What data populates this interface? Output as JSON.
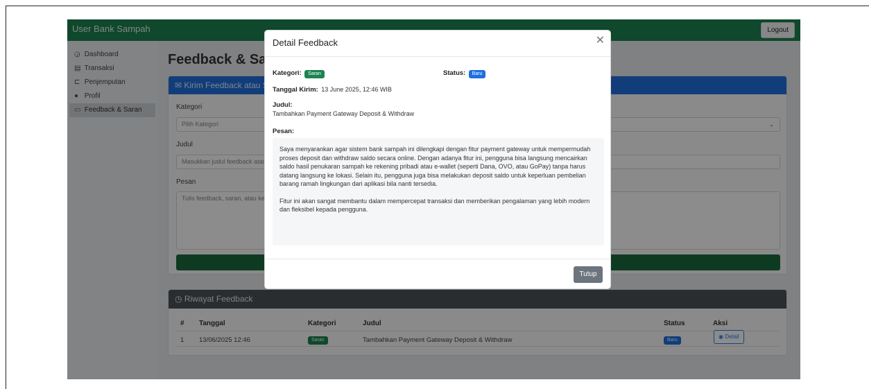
{
  "navbar": {
    "brand": "User Bank Sampah",
    "logout": "Logout"
  },
  "sidebar": {
    "items": [
      {
        "label": "Dashboard",
        "icon": "dashboard-icon",
        "glyph": "◶"
      },
      {
        "label": "Transaksi",
        "icon": "receipt-icon",
        "glyph": "▤"
      },
      {
        "label": "Penjemputan",
        "icon": "truck-icon",
        "glyph": "⊏"
      },
      {
        "label": "Profil",
        "icon": "person-icon",
        "glyph": "●"
      },
      {
        "label": "Feedback & Saran",
        "icon": "chat-icon",
        "glyph": "▭",
        "active": true
      }
    ]
  },
  "main": {
    "title": "Feedback & Saran",
    "form": {
      "header": "Kirim Feedback atau Saran",
      "kategori_label": "Kategori",
      "kategori_value": "Pilih Kategori",
      "judul_label": "Judul",
      "judul_placeholder": "Masukkan judul feedback atau saran",
      "pesan_label": "Pesan",
      "pesan_placeholder": "Tulis feedback, saran, atau keluhan Anda di sini..."
    },
    "history": {
      "header": "Riwayat Feedback",
      "columns": [
        "#",
        "Tanggal",
        "Kategori",
        "Judul",
        "Status",
        "Aksi"
      ],
      "rows": [
        {
          "no": "1",
          "tanggal": "13/06/2025 12:46",
          "kategori": "Saran",
          "judul": "Tambahkan Payment Gateway Deposit & Withdraw",
          "status": "Baru",
          "aksi": "Detail"
        }
      ]
    }
  },
  "modal": {
    "title": "Detail Feedback",
    "kategori_key": "Kategori:",
    "kategori_val": "Saran",
    "status_key": "Status:",
    "status_val": "Baru",
    "tanggal_key": "Tanggal Kirim:",
    "tanggal_val": "13 June 2025, 12:46 WIB",
    "judul_key": "Judul:",
    "judul_val": "Tambahkan Payment Gateway Deposit & Withdraw",
    "pesan_key": "Pesan:",
    "pesan_p1": "Saya menyarankan agar sistem bank sampah ini dilengkapi dengan fitur payment gateway untuk mempermudah proses deposit dan withdraw saldo secara online. Dengan adanya fitur ini, pengguna bisa langsung mencairkan saldo hasil penukaran sampah ke rekening pribadi atau e-wallet (seperti Dana, OVO, atau GoPay) tanpa harus datang langsung ke lokasi. Selain itu, pengguna juga bisa melakukan deposit saldo untuk keperluan pembelian barang ramah lingkungan dari aplikasi bila nanti tersedia.",
    "pesan_p2": "Fitur ini akan sangat membantu dalam mempercepat transaksi dan memberikan pengalaman yang lebih modern dan fleksibel kepada pengguna.",
    "close_button": "Tutup"
  },
  "colors": {
    "brand_green": "#1c8350",
    "primary_blue": "#1f6fe0",
    "secondary_gray": "#6c757d"
  }
}
